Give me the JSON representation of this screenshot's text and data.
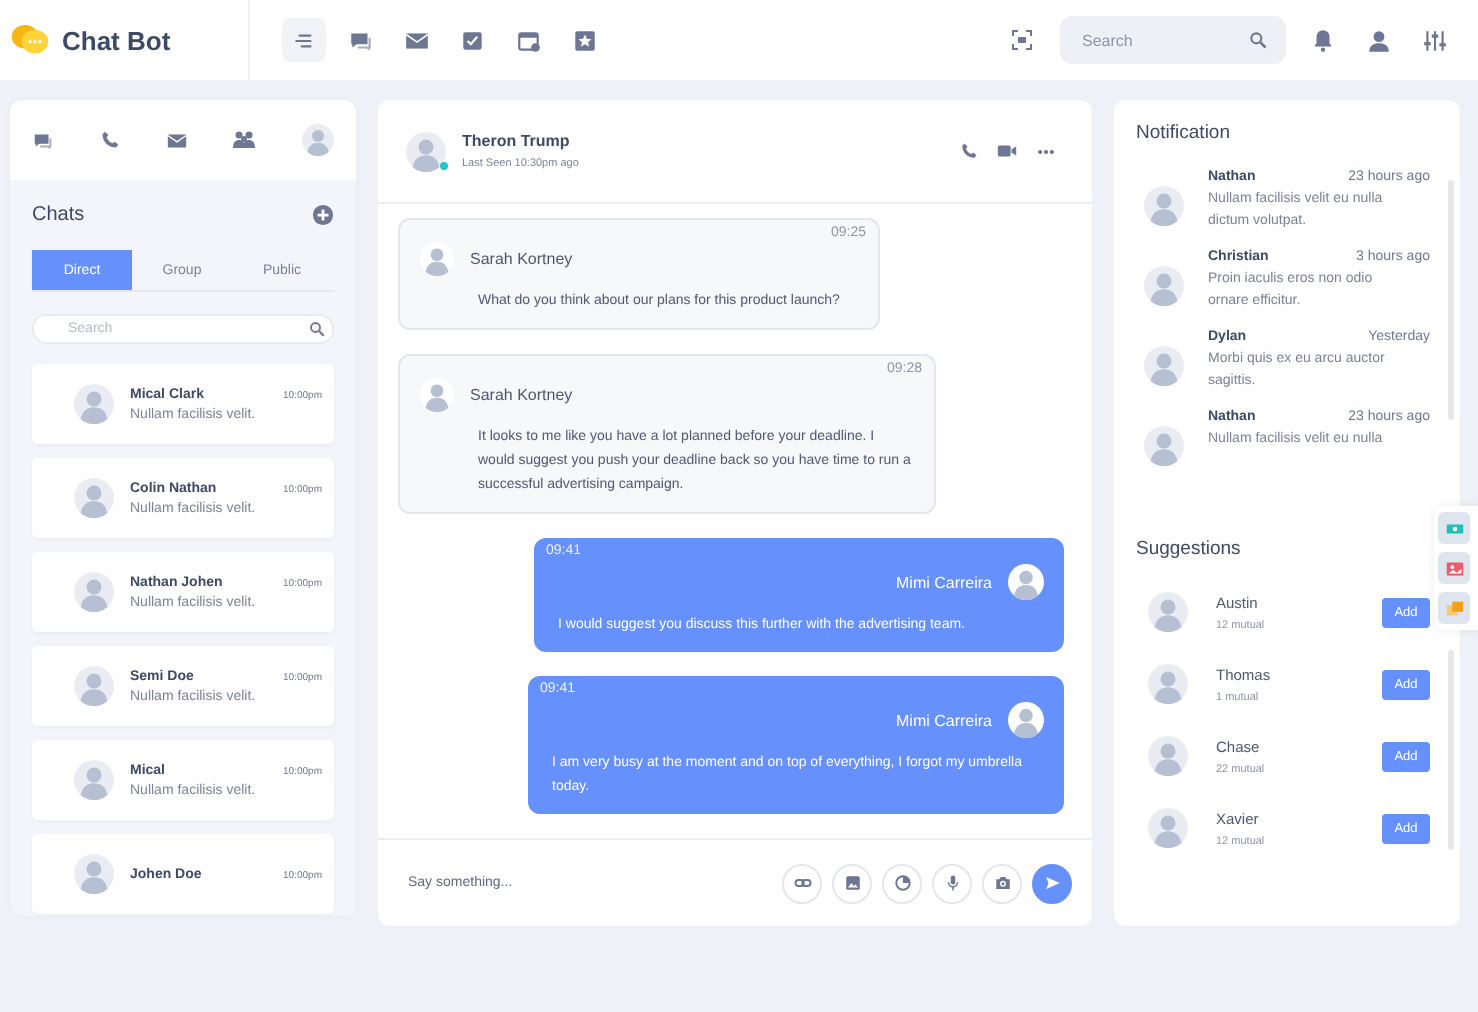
{
  "header": {
    "logo": "Chat Bot",
    "nav": [
      {
        "selected": true
      },
      {
        "selected": false
      },
      {
        "selected": false
      },
      {
        "selected": false
      },
      {
        "selected": false
      },
      {
        "selected": false
      }
    ],
    "search": {
      "placeholder": "Search"
    }
  },
  "chats_panel": {
    "title": "Chats",
    "tabs": [
      {
        "label": "Direct",
        "selected": true
      },
      {
        "label": "Group",
        "selected": false
      },
      {
        "label": "Public",
        "selected": false
      }
    ],
    "search": {
      "placeholder": "Search"
    },
    "chats": [
      {
        "name": "Mical Clark",
        "time": "10:00pm",
        "preview": "Nullam facilisis velit."
      },
      {
        "name": "Colin Nathan",
        "time": "10:00pm",
        "preview": "Nullam facilisis velit."
      },
      {
        "name": "Nathan Johen",
        "time": "10:00pm",
        "preview": "Nullam facilisis velit."
      },
      {
        "name": "Semi Doe",
        "time": "10:00pm",
        "preview": "Nullam facilisis velit."
      },
      {
        "name": "Mical",
        "time": "10:00pm",
        "preview": "Nullam facilisis velit."
      },
      {
        "name": "Johen Doe",
        "time": "10:00pm"
      }
    ]
  },
  "conversation": {
    "contact": {
      "name": "Theron Trump",
      "status": "Last Seen 10:30pm ago",
      "online": true
    },
    "messages": [
      {
        "kind": "incoming",
        "time": "09:25",
        "sender": "Sarah Kortney",
        "text": "What do you think about our plans for this product launch?"
      },
      {
        "kind": "incoming",
        "time": "09:28",
        "sender": "Sarah Kortney",
        "text": "It looks to me like you have a lot planned before your deadline. I would suggest you push your deadline back so you have time to run a successful advertising campaign."
      },
      {
        "kind": "outgoing",
        "time": "09:41",
        "sender": "Mimi Carreira",
        "text": "I would suggest you discuss this further with the advertising team."
      },
      {
        "kind": "outgoing",
        "time": "09:41",
        "sender": "Mimi Carreira",
        "text": "I am very busy at the moment and on top of everything, I forgot my umbrella today."
      }
    ],
    "composer": {
      "placeholder": "Say something..."
    }
  },
  "notifications": {
    "title": "Notification",
    "items": [
      {
        "name": "Nathan",
        "time": "23 hours ago",
        "text": "Nullam facilisis velit eu nulla dictum volutpat."
      },
      {
        "name": "Christian",
        "time": "3 hours ago",
        "text": "Proin iaculis eros non odio ornare efficitur."
      },
      {
        "name": "Dylan",
        "time": "Yesterday",
        "text": "Morbi quis ex eu arcu auctor sagittis."
      },
      {
        "name": "Nathan",
        "time": "23 hours ago",
        "text": "Nullam facilisis velit eu nulla"
      }
    ]
  },
  "suggestions": {
    "title": "Suggestions",
    "items": [
      {
        "name": "Austin",
        "mutual": "12 mutual",
        "button": "Add"
      },
      {
        "name": "Thomas",
        "mutual": "1 mutual",
        "button": "Add"
      },
      {
        "name": "Chase",
        "mutual": "22 mutual",
        "button": "Add"
      },
      {
        "name": "Xavier",
        "mutual": "12 mutual",
        "button": "Add"
      }
    ]
  }
}
